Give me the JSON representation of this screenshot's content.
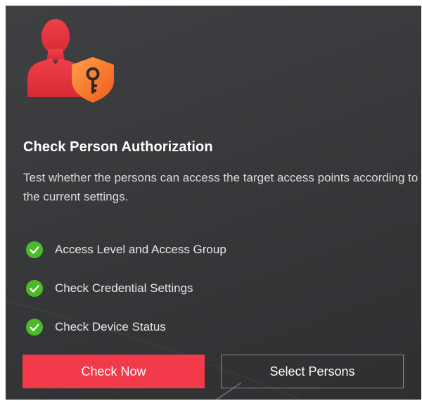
{
  "card": {
    "hero_icon": "person-key-shield-icon",
    "title": "Check Person Authorization",
    "description": "Test whether the persons can access the target access points according to the current settings.",
    "checks": [
      {
        "icon": "green-check-circle-icon",
        "label": "Access Level and Access Group"
      },
      {
        "icon": "green-check-circle-icon",
        "label": "Check Credential Settings"
      },
      {
        "icon": "green-check-circle-icon",
        "label": "Check Device Status"
      }
    ],
    "buttons": {
      "check_now": "Check Now",
      "select_persons": "Select Persons"
    }
  },
  "colors": {
    "panel_background": "#3a3b3d",
    "primary_accent": "#f23a4a",
    "check_green": "#4cbb2a",
    "shield_orange": "#f46a22",
    "person_red": "#e8343f"
  }
}
